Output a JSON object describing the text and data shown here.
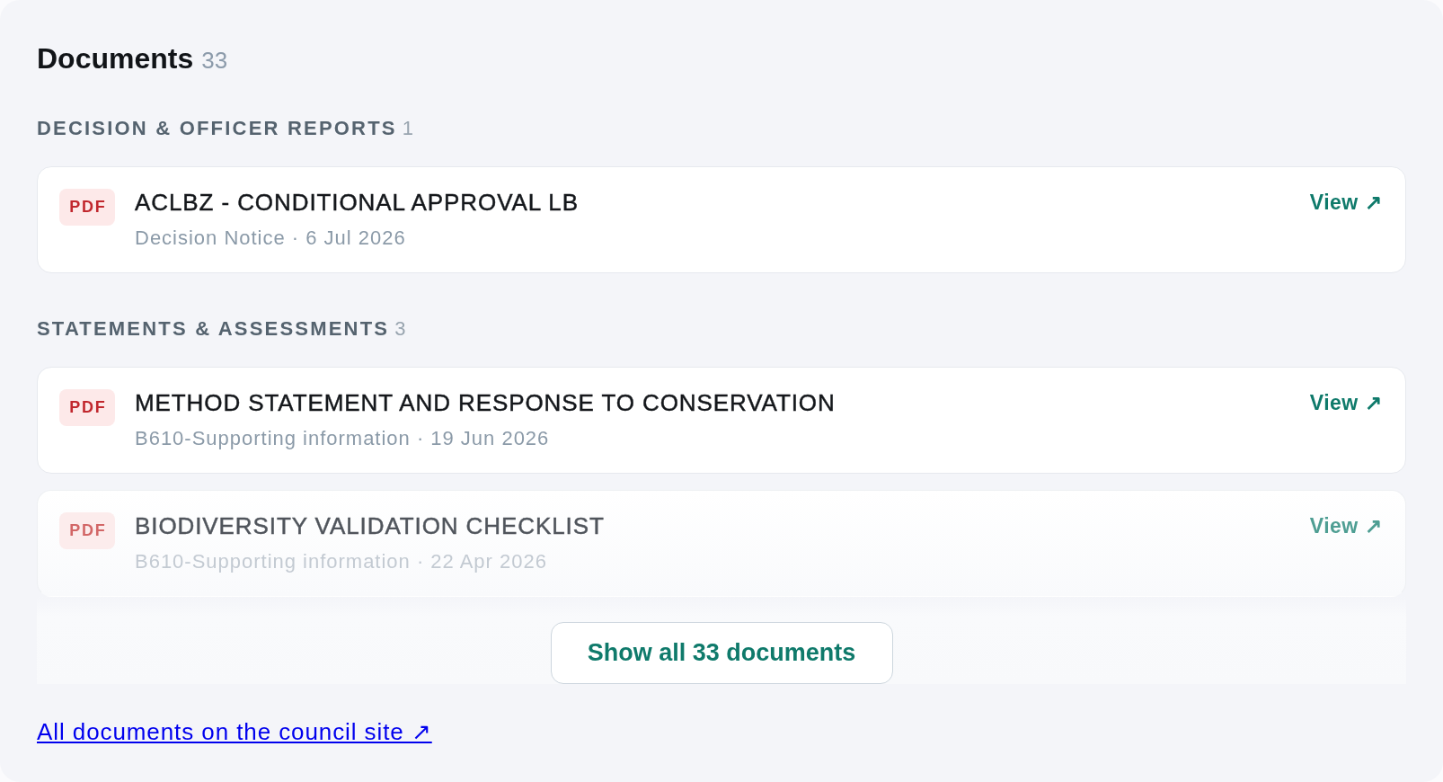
{
  "header": {
    "title": "Documents",
    "count": "33"
  },
  "sections": [
    {
      "title": "DECISION & OFFICER REPORTS",
      "count": "1",
      "documents": [
        {
          "file_type": "PDF",
          "title": "ACLBZ - CONDITIONAL APPROVAL LB",
          "meta": "Decision Notice · 6 Jul 2026",
          "action": "View ↗",
          "faded": false
        }
      ]
    },
    {
      "title": "STATEMENTS & ASSESSMENTS",
      "count": "3",
      "documents": [
        {
          "file_type": "PDF",
          "title": "METHOD STATEMENT AND RESPONSE TO CONSERVATION",
          "meta": "B610-Supporting information · 19 Jun 2026",
          "action": "View ↗",
          "faded": false
        },
        {
          "file_type": "PDF",
          "title": "BIODIVERSITY VALIDATION CHECKLIST",
          "meta": "B610-Supporting information · 22 Apr 2026",
          "action": "View ↗",
          "faded": true
        }
      ]
    }
  ],
  "show_all_button": "Show all 33 documents",
  "footer_link": "All documents on the council site ↗"
}
